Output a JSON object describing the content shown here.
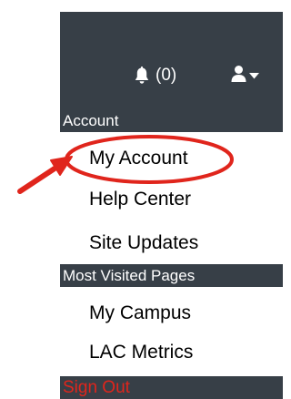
{
  "header": {
    "notifications": {
      "icon": "bell-icon",
      "count_label": "(0)"
    },
    "user_menu": {
      "icon": "user-icon",
      "caret": "caret-down-icon"
    }
  },
  "account_section": {
    "title": "Account",
    "items": [
      {
        "label": "My Account"
      },
      {
        "label": "Help Center"
      },
      {
        "label": "Site Updates"
      }
    ]
  },
  "most_visited_section": {
    "title": "Most Visited Pages",
    "items": [
      {
        "label": "My Campus"
      },
      {
        "label": "LAC Metrics"
      }
    ]
  },
  "sign_out": {
    "label": "Sign Out"
  },
  "colors": {
    "panel_dark": "#373f47",
    "sign_out_text": "#e0251c",
    "annotation": "#e0251c"
  }
}
